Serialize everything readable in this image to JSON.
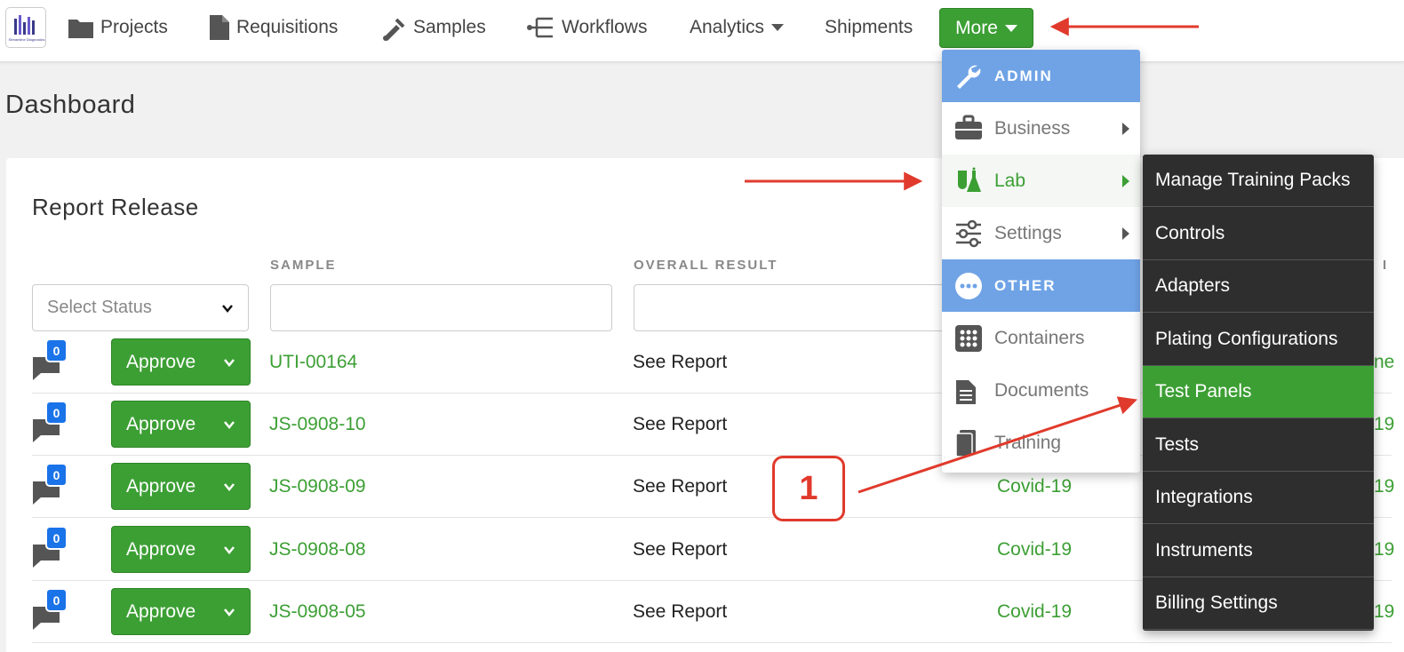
{
  "nav": {
    "logo_text": "Streamline Diagnostics",
    "items": [
      {
        "label": "Projects",
        "icon": "folder-icon"
      },
      {
        "label": "Requisitions",
        "icon": "document-icon"
      },
      {
        "label": "Samples",
        "icon": "pipette-icon"
      },
      {
        "label": "Workflows",
        "icon": "workflow-icon"
      },
      {
        "label": "Analytics",
        "icon": "caret-down-icon"
      },
      {
        "label": "Shipments",
        "icon": ""
      }
    ],
    "more_label": "More"
  },
  "page": {
    "title": "Dashboard"
  },
  "report_release": {
    "title": "Report Release",
    "columns": {
      "sample": "SAMPLE",
      "overall_result": "OVERALL RESULT",
      "edge_partial": "I"
    },
    "status_placeholder": "Select Status",
    "approve_label": "Approve",
    "rows": [
      {
        "comments": "0",
        "sample": "UTI-00164",
        "result": "See Report",
        "panel": "",
        "edge": "ne"
      },
      {
        "comments": "0",
        "sample": "JS-0908-10",
        "result": "See Report",
        "panel": "",
        "edge": "19"
      },
      {
        "comments": "0",
        "sample": "JS-0908-09",
        "result": "See Report",
        "panel": "Covid-19",
        "edge": "19"
      },
      {
        "comments": "0",
        "sample": "JS-0908-08",
        "result": "See Report",
        "panel": "Covid-19",
        "edge": "19"
      },
      {
        "comments": "0",
        "sample": "JS-0908-05",
        "result": "See Report",
        "panel": "Covid-19",
        "edge": "19"
      }
    ]
  },
  "more_menu": {
    "admin_header": "ADMIN",
    "business": "Business",
    "lab": "Lab",
    "settings": "Settings",
    "other_header": "OTHER",
    "containers": "Containers",
    "documents": "Documents",
    "training": "Training"
  },
  "lab_submenu": [
    {
      "label": "Manage Training Packs",
      "active": false
    },
    {
      "label": "Controls",
      "active": false
    },
    {
      "label": "Adapters",
      "active": false
    },
    {
      "label": "Plating Configurations",
      "active": false
    },
    {
      "label": "Test Panels",
      "active": true
    },
    {
      "label": "Tests",
      "active": false
    },
    {
      "label": "Integrations",
      "active": false
    },
    {
      "label": "Instruments",
      "active": false
    },
    {
      "label": "Billing Settings",
      "active": false
    }
  ],
  "annotation": {
    "step": "1"
  },
  "colors": {
    "accent_green": "#3c9f34",
    "header_blue": "#6fa3e6",
    "submenu_dark": "#2e2e2e",
    "annotation_red": "#e03a2c"
  }
}
